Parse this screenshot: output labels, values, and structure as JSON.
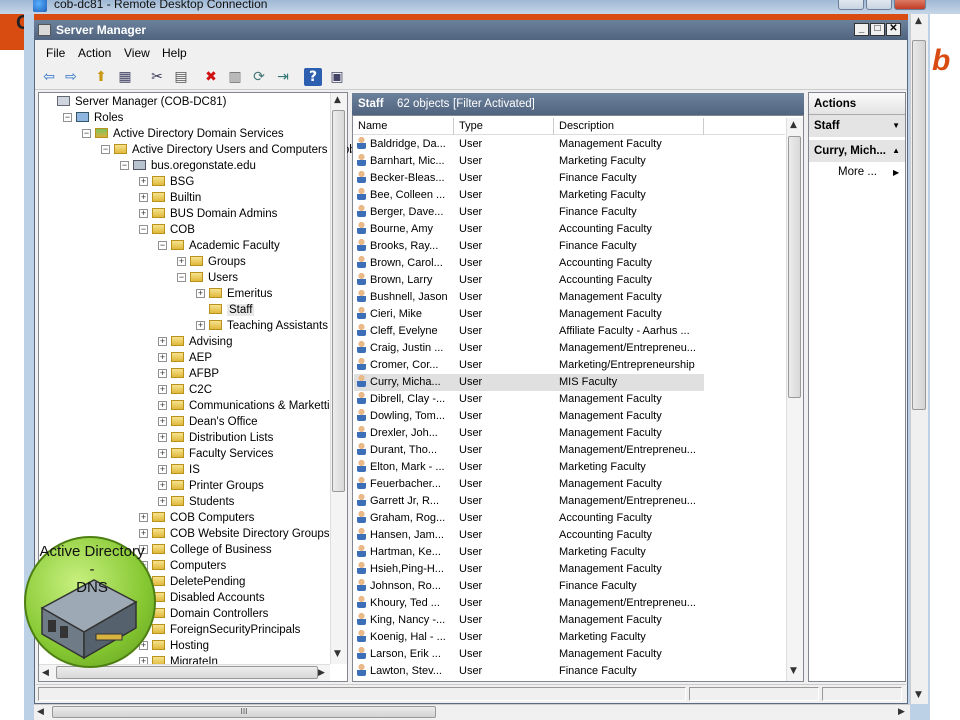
{
  "rdp": {
    "title": "cob-dc81 - Remote Desktop Connection",
    "hscroll_grip": "III"
  },
  "sm": {
    "title": "Server Manager",
    "menu": [
      "File",
      "Action",
      "View",
      "Help"
    ]
  },
  "tree": {
    "nodes": [
      {
        "label": "Server Manager (COB-DC81)",
        "depth": 0,
        "exp": "",
        "icon": "server-manager-icon"
      },
      {
        "label": "Roles",
        "depth": 1,
        "exp": "−",
        "icon": "roles-icon"
      },
      {
        "label": "Active Directory Domain Services",
        "depth": 2,
        "exp": "−",
        "icon": "ad-ds-icon"
      },
      {
        "label": "Active Directory Users and Computers [ cob-",
        "depth": 3,
        "exp": "−",
        "icon": "ad-users-computers-icon"
      },
      {
        "label": "bus.oregonstate.edu",
        "depth": 4,
        "exp": "−",
        "icon": "domain-icon"
      },
      {
        "label": "BSG",
        "depth": 5,
        "exp": "+",
        "icon": "folder-icon"
      },
      {
        "label": "Builtin",
        "depth": 5,
        "exp": "+",
        "icon": "folder-icon"
      },
      {
        "label": "BUS Domain Admins",
        "depth": 5,
        "exp": "+",
        "icon": "folder-icon"
      },
      {
        "label": "COB",
        "depth": 5,
        "exp": "−",
        "icon": "folder-icon"
      },
      {
        "label": "Academic Faculty",
        "depth": 6,
        "exp": "−",
        "icon": "folder-icon"
      },
      {
        "label": "Groups",
        "depth": 7,
        "exp": "+",
        "icon": "folder-icon"
      },
      {
        "label": "Users",
        "depth": 7,
        "exp": "−",
        "icon": "folder-icon"
      },
      {
        "label": "Emeritus",
        "depth": 8,
        "exp": "+",
        "icon": "folder-icon"
      },
      {
        "label": "Staff",
        "depth": 8,
        "exp": "",
        "icon": "folder-icon",
        "selected": true
      },
      {
        "label": "Teaching Assistants",
        "depth": 8,
        "exp": "+",
        "icon": "folder-icon"
      },
      {
        "label": "Advising",
        "depth": 6,
        "exp": "+",
        "icon": "folder-icon"
      },
      {
        "label": "AEP",
        "depth": 6,
        "exp": "+",
        "icon": "folder-icon"
      },
      {
        "label": "AFBP",
        "depth": 6,
        "exp": "+",
        "icon": "folder-icon"
      },
      {
        "label": "C2C",
        "depth": 6,
        "exp": "+",
        "icon": "folder-icon"
      },
      {
        "label": "Communications & Marketting",
        "depth": 6,
        "exp": "+",
        "icon": "folder-icon"
      },
      {
        "label": "Dean's Office",
        "depth": 6,
        "exp": "+",
        "icon": "folder-icon"
      },
      {
        "label": "Distribution Lists",
        "depth": 6,
        "exp": "+",
        "icon": "folder-icon"
      },
      {
        "label": "Faculty Services",
        "depth": 6,
        "exp": "+",
        "icon": "folder-icon"
      },
      {
        "label": "IS",
        "depth": 6,
        "exp": "+",
        "icon": "folder-icon"
      },
      {
        "label": "Printer Groups",
        "depth": 6,
        "exp": "+",
        "icon": "folder-icon"
      },
      {
        "label": "Students",
        "depth": 6,
        "exp": "+",
        "icon": "folder-icon"
      },
      {
        "label": "COB Computers",
        "depth": 5,
        "exp": "+",
        "icon": "folder-icon"
      },
      {
        "label": "COB Website Directory Groups",
        "depth": 5,
        "exp": "+",
        "icon": "folder-icon"
      },
      {
        "label": "College of Business",
        "depth": 5,
        "exp": "+",
        "icon": "folder-icon"
      },
      {
        "label": "Computers",
        "depth": 5,
        "exp": "+",
        "icon": "folder-icon"
      },
      {
        "label": "DeletePending",
        "depth": 5,
        "exp": "+",
        "icon": "folder-icon"
      },
      {
        "label": "Disabled Accounts",
        "depth": 5,
        "exp": "+",
        "icon": "folder-icon"
      },
      {
        "label": "Domain Controllers",
        "depth": 5,
        "exp": "+",
        "icon": "folder-icon"
      },
      {
        "label": "ForeignSecurityPrincipals",
        "depth": 5,
        "exp": "+",
        "icon": "folder-icon"
      },
      {
        "label": "Hosting",
        "depth": 5,
        "exp": "+",
        "icon": "folder-icon"
      },
      {
        "label": "MigrateIn",
        "depth": 5,
        "exp": "+",
        "icon": "folder-icon"
      }
    ]
  },
  "list": {
    "title": "Staff",
    "count": "62 objects",
    "filter": "[Filter Activated]",
    "columns": [
      "Name",
      "Type",
      "Description"
    ],
    "rows": [
      [
        "Baldridge, Da...",
        "User",
        "Management Faculty"
      ],
      [
        "Barnhart, Mic...",
        "User",
        "Marketing Faculty"
      ],
      [
        "Becker-Bleas...",
        "User",
        "Finance Faculty"
      ],
      [
        "Bee, Colleen ...",
        "User",
        "Marketing Faculty"
      ],
      [
        "Berger, Dave...",
        "User",
        "Finance Faculty"
      ],
      [
        "Bourne, Amy",
        "User",
        "Accounting Faculty"
      ],
      [
        "Brooks, Ray...",
        "User",
        "Finance Faculty"
      ],
      [
        "Brown, Carol...",
        "User",
        "Accounting Faculty"
      ],
      [
        "Brown, Larry",
        "User",
        "Accounting Faculty"
      ],
      [
        "Bushnell, Jason",
        "User",
        "Management Faculty"
      ],
      [
        "Cieri, Mike",
        "User",
        "Management Faculty"
      ],
      [
        "Cleff, Evelyne",
        "User",
        "Affiliate Faculty - Aarhus ..."
      ],
      [
        "Craig, Justin ...",
        "User",
        "Management/Entrepreneu..."
      ],
      [
        "Cromer, Cor...",
        "User",
        "Marketing/Entrepreneurship"
      ],
      [
        "Curry, Micha...",
        "User",
        "MIS Faculty"
      ],
      [
        "Dibrell, Clay -...",
        "User",
        "Management Faculty"
      ],
      [
        "Dowling, Tom...",
        "User",
        "Management Faculty"
      ],
      [
        "Drexler, Joh...",
        "User",
        "Management Faculty"
      ],
      [
        "Durant, Tho...",
        "User",
        "Management/Entrepreneu..."
      ],
      [
        "Elton, Mark - ...",
        "User",
        "Marketing Faculty"
      ],
      [
        "Feuerbacher...",
        "User",
        "Management Faculty"
      ],
      [
        "Garrett Jr, R...",
        "User",
        "Management/Entrepreneu..."
      ],
      [
        "Graham, Rog...",
        "User",
        "Accounting Faculty"
      ],
      [
        "Hansen, Jam...",
        "User",
        "Accounting Faculty"
      ],
      [
        "Hartman, Ke...",
        "User",
        "Marketing Faculty"
      ],
      [
        "Hsieh,Ping-H...",
        "User",
        "Management Faculty"
      ],
      [
        "Johnson, Ro...",
        "User",
        "Finance Faculty"
      ],
      [
        "Khoury, Ted ...",
        "User",
        "Management/Entrepreneu..."
      ],
      [
        "King, Nancy -...",
        "User",
        "Management Faculty"
      ],
      [
        "Koenig, Hal - ...",
        "User",
        "Marketing Faculty"
      ],
      [
        "Larson, Erik ...",
        "User",
        "Management Faculty"
      ],
      [
        "Lawton, Stev...",
        "User",
        "Finance Faculty"
      ]
    ],
    "highlighted_index": 14
  },
  "actions": {
    "title": "Actions",
    "section1": "Staff",
    "section2": "Curry, Mich...",
    "more": "More ..."
  },
  "overlay": {
    "label": "Active Directory -\nDNS"
  },
  "colors": {
    "accent_orange": "#d84c12",
    "header_blue": "#5a6f8c"
  }
}
